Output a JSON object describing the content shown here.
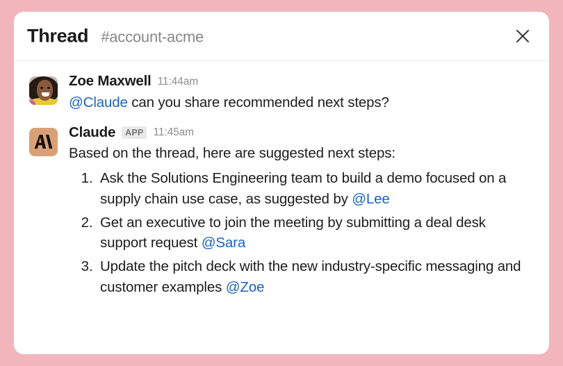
{
  "window": {
    "background_color": "#f2b5bb",
    "card_background": "#ffffff"
  },
  "header": {
    "title": "Thread",
    "channel": "#account-acme",
    "close_icon": "close-icon"
  },
  "colors": {
    "mention_blue": "#1a64c4",
    "app_avatar_bg": "#d9a077",
    "badge_bg": "#e9e9e9",
    "text": "#1d1c1d",
    "muted": "#8d8d8d"
  },
  "messages": [
    {
      "author": "Zoe Maxwell",
      "timestamp": "11:44am",
      "avatar_type": "photo",
      "badge": null,
      "text_parts": [
        {
          "type": "mention",
          "text": "@Claude"
        },
        {
          "type": "plain",
          "text": " can you share recommended next steps?"
        }
      ],
      "mention": "@Claude",
      "body": " can you share recommended next steps?"
    },
    {
      "author": "Claude",
      "timestamp": "11:45am",
      "avatar_type": "app-logo",
      "badge": "APP",
      "intro": "Based on the thread, here are suggested next steps:",
      "steps": [
        {
          "text": "Ask the Solutions Engineering team to build a demo focused on a supply chain use case, as suggested by ",
          "mention": "@Lee"
        },
        {
          "text": "Get an executive to join the meeting by submitting a deal desk support request ",
          "mention": "@Sara"
        },
        {
          "text": "Update the pitch deck with the new industry-specific messaging and customer examples ",
          "mention": "@Zoe"
        }
      ]
    }
  ]
}
